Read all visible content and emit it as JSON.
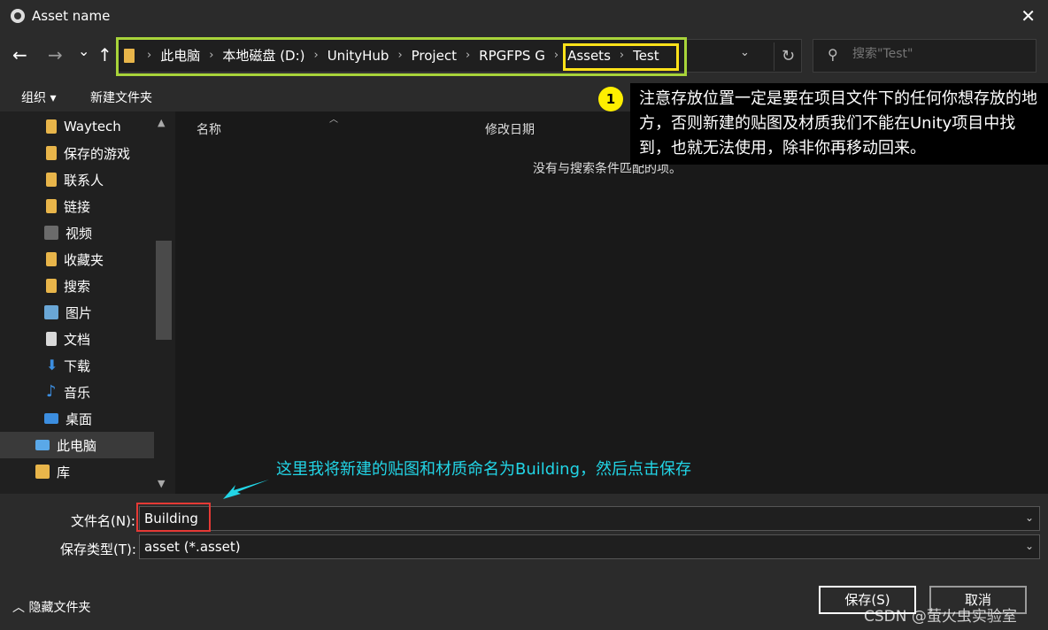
{
  "window": {
    "title": "Asset name"
  },
  "nav": {
    "back": "←",
    "forward": "→",
    "history": "⌄",
    "up": "↑"
  },
  "breadcrumb": [
    {
      "label": "此电脑"
    },
    {
      "label": "本地磁盘 (D:)"
    },
    {
      "label": "UnityHub"
    },
    {
      "label": "Project"
    },
    {
      "label": "RPGFPS G"
    },
    {
      "label": "Assets"
    },
    {
      "label": "Test"
    }
  ],
  "search": {
    "placeholder": "搜索\"Test\""
  },
  "toolbar": {
    "organize": "组织 ▾",
    "new_folder": "新建文件夹"
  },
  "sidebar": {
    "items": [
      {
        "label": "Waytech",
        "icon": "folder-icon",
        "color": "#e8b54a"
      },
      {
        "label": "保存的游戏",
        "icon": "saved-games-icon",
        "color": "#e8b54a"
      },
      {
        "label": "联系人",
        "icon": "contacts-icon",
        "color": "#e8b54a"
      },
      {
        "label": "链接",
        "icon": "links-icon",
        "color": "#e8b54a"
      },
      {
        "label": "视频",
        "icon": "video-icon",
        "color": "#6b6b6b"
      },
      {
        "label": "收藏夹",
        "icon": "favorites-icon",
        "color": "#e8b54a"
      },
      {
        "label": "搜索",
        "icon": "search-folder-icon",
        "color": "#e8b54a"
      },
      {
        "label": "图片",
        "icon": "pictures-icon",
        "color": "#6aa7d6"
      },
      {
        "label": "文档",
        "icon": "documents-icon",
        "color": "#d9d9d9"
      },
      {
        "label": "下载",
        "icon": "downloads-icon",
        "color": "#3c8ee0"
      },
      {
        "label": "音乐",
        "icon": "music-icon",
        "color": "#3c8ee0"
      },
      {
        "label": "桌面",
        "icon": "desktop-icon",
        "color": "#3c8ee0"
      },
      {
        "label": "此电脑",
        "icon": "this-pc-icon",
        "color": "#5aa8e8"
      },
      {
        "label": "库",
        "icon": "library-icon",
        "color": "#e8b54a"
      }
    ]
  },
  "content": {
    "columns": [
      "名称",
      "修改日期"
    ],
    "empty_message": "没有与搜索条件匹配的项。"
  },
  "callout": {
    "number": "1",
    "text": "注意存放位置一定是要在项目文件下的任何你想存放的地方，否则新建的贴图及材质我们不能在Unity项目中找到，也就无法使用，除非你再移动回来。"
  },
  "annotation": {
    "text": "这里我将新建的贴图和材质命名为Building，然后点击保存"
  },
  "filename": {
    "label": "文件名(N):",
    "value": "Building"
  },
  "filetype": {
    "label": "保存类型(T):",
    "value": "asset (*.asset)"
  },
  "footer": {
    "hide_folders": "隐藏文件夹",
    "save": "保存(S)",
    "cancel": "取消"
  },
  "watermark": "CSDN @萤火虫实验室",
  "colors": {
    "frame_green": "#a8d43a",
    "frame_yellow": "#ffe21a",
    "frame_red": "#e53935",
    "annotation_cyan": "#22d5e6",
    "badge": "#ffef00"
  }
}
